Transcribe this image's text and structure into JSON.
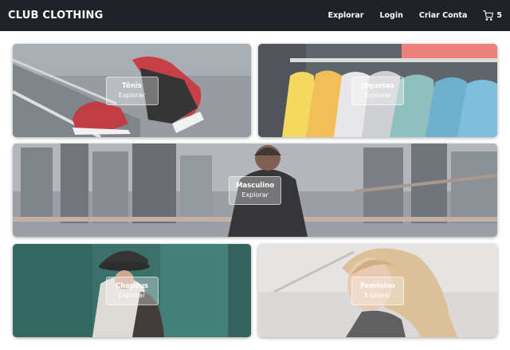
{
  "brand": "CLUB CLOTHING",
  "nav": {
    "explore": "Explorar",
    "login": "Login",
    "signup": "Criar Conta",
    "cart_count": "5"
  },
  "icons": {
    "cart": "cart-icon"
  },
  "tiles": [
    {
      "title": "Tênis",
      "action": "Explorar"
    },
    {
      "title": "Jaquetas",
      "action": "Explorar"
    },
    {
      "title": "Masculino",
      "action": "Explorar"
    },
    {
      "title": "Chapéus",
      "action": "Explorar"
    },
    {
      "title": "Feminino",
      "action": "Explorar"
    }
  ],
  "colors": {
    "navbar": "#1f2226",
    "text_light": "#ffffff"
  }
}
